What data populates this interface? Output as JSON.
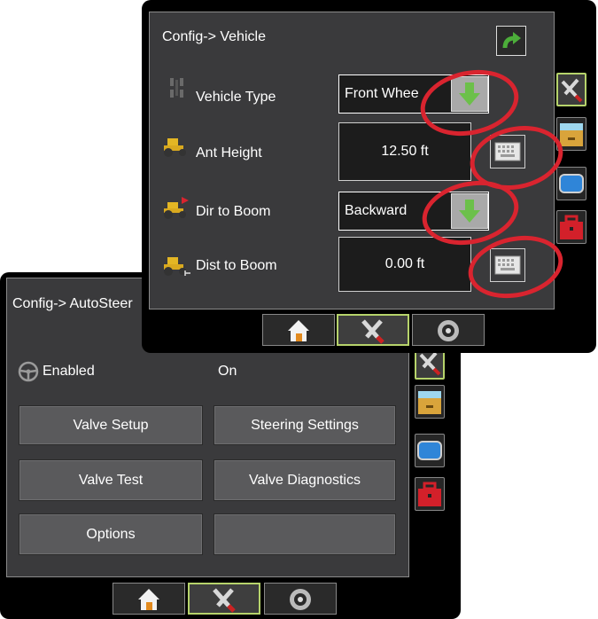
{
  "autosteer_screen": {
    "title": "Config-> AutoSteer",
    "enabled_label": "Enabled",
    "enabled_value": "On",
    "buttons": {
      "valve_setup": "Valve Setup",
      "steering_settings": "Steering Settings",
      "valve_test": "Valve Test",
      "valve_diagnostics": "Valve Diagnostics",
      "options": "Options",
      "blank": ""
    },
    "side_tabs": [
      "tools-icon",
      "filing-cabinet-icon",
      "display-icon",
      "toolbox-icon"
    ],
    "bottom_tabs": [
      "home-icon",
      "tools-icon",
      "gauge-icon"
    ],
    "active_bottom_tab": "tools-icon"
  },
  "vehicle_screen": {
    "title": "Config-> Vehicle",
    "rows": [
      {
        "label": "Vehicle Type",
        "value": "Front Whee",
        "control": "dropdown"
      },
      {
        "label": "Ant Height",
        "value": "12.50 ft",
        "control": "keyboard"
      },
      {
        "label": "Dir to Boom",
        "value": "Backward",
        "control": "dropdown"
      },
      {
        "label": "Dist to Boom",
        "value": "0.00 ft",
        "control": "keyboard"
      }
    ],
    "side_tabs": [
      "tools-icon",
      "filing-cabinet-icon",
      "display-icon",
      "toolbox-icon"
    ],
    "bottom_tabs": [
      "home-icon",
      "tools-icon",
      "gauge-icon"
    ],
    "active_bottom_tab": "tools-icon"
  },
  "colors": {
    "panel": "#3a3a3c",
    "accent_active": "#b6d36b",
    "highlight_ring": "#d9242f",
    "dropdown_arrow": "#6cc04a"
  }
}
